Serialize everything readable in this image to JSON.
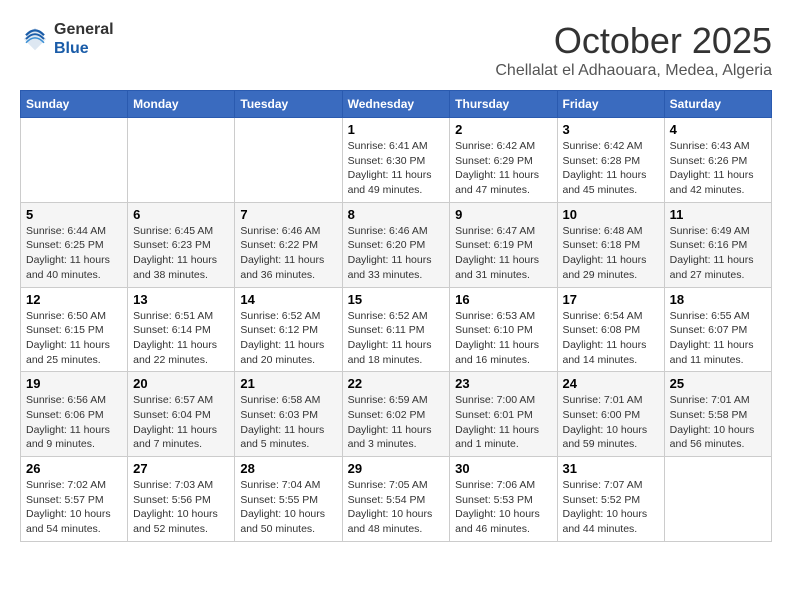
{
  "header": {
    "logo_general": "General",
    "logo_blue": "Blue",
    "month_title": "October 2025",
    "subtitle": "Chellalat el Adhaouara, Medea, Algeria"
  },
  "calendar": {
    "weekdays": [
      "Sunday",
      "Monday",
      "Tuesday",
      "Wednesday",
      "Thursday",
      "Friday",
      "Saturday"
    ],
    "weeks": [
      [
        {
          "day": "",
          "info": ""
        },
        {
          "day": "",
          "info": ""
        },
        {
          "day": "",
          "info": ""
        },
        {
          "day": "1",
          "info": "Sunrise: 6:41 AM\nSunset: 6:30 PM\nDaylight: 11 hours and 49 minutes."
        },
        {
          "day": "2",
          "info": "Sunrise: 6:42 AM\nSunset: 6:29 PM\nDaylight: 11 hours and 47 minutes."
        },
        {
          "day": "3",
          "info": "Sunrise: 6:42 AM\nSunset: 6:28 PM\nDaylight: 11 hours and 45 minutes."
        },
        {
          "day": "4",
          "info": "Sunrise: 6:43 AM\nSunset: 6:26 PM\nDaylight: 11 hours and 42 minutes."
        }
      ],
      [
        {
          "day": "5",
          "info": "Sunrise: 6:44 AM\nSunset: 6:25 PM\nDaylight: 11 hours and 40 minutes."
        },
        {
          "day": "6",
          "info": "Sunrise: 6:45 AM\nSunset: 6:23 PM\nDaylight: 11 hours and 38 minutes."
        },
        {
          "day": "7",
          "info": "Sunrise: 6:46 AM\nSunset: 6:22 PM\nDaylight: 11 hours and 36 minutes."
        },
        {
          "day": "8",
          "info": "Sunrise: 6:46 AM\nSunset: 6:20 PM\nDaylight: 11 hours and 33 minutes."
        },
        {
          "day": "9",
          "info": "Sunrise: 6:47 AM\nSunset: 6:19 PM\nDaylight: 11 hours and 31 minutes."
        },
        {
          "day": "10",
          "info": "Sunrise: 6:48 AM\nSunset: 6:18 PM\nDaylight: 11 hours and 29 minutes."
        },
        {
          "day": "11",
          "info": "Sunrise: 6:49 AM\nSunset: 6:16 PM\nDaylight: 11 hours and 27 minutes."
        }
      ],
      [
        {
          "day": "12",
          "info": "Sunrise: 6:50 AM\nSunset: 6:15 PM\nDaylight: 11 hours and 25 minutes."
        },
        {
          "day": "13",
          "info": "Sunrise: 6:51 AM\nSunset: 6:14 PM\nDaylight: 11 hours and 22 minutes."
        },
        {
          "day": "14",
          "info": "Sunrise: 6:52 AM\nSunset: 6:12 PM\nDaylight: 11 hours and 20 minutes."
        },
        {
          "day": "15",
          "info": "Sunrise: 6:52 AM\nSunset: 6:11 PM\nDaylight: 11 hours and 18 minutes."
        },
        {
          "day": "16",
          "info": "Sunrise: 6:53 AM\nSunset: 6:10 PM\nDaylight: 11 hours and 16 minutes."
        },
        {
          "day": "17",
          "info": "Sunrise: 6:54 AM\nSunset: 6:08 PM\nDaylight: 11 hours and 14 minutes."
        },
        {
          "day": "18",
          "info": "Sunrise: 6:55 AM\nSunset: 6:07 PM\nDaylight: 11 hours and 11 minutes."
        }
      ],
      [
        {
          "day": "19",
          "info": "Sunrise: 6:56 AM\nSunset: 6:06 PM\nDaylight: 11 hours and 9 minutes."
        },
        {
          "day": "20",
          "info": "Sunrise: 6:57 AM\nSunset: 6:04 PM\nDaylight: 11 hours and 7 minutes."
        },
        {
          "day": "21",
          "info": "Sunrise: 6:58 AM\nSunset: 6:03 PM\nDaylight: 11 hours and 5 minutes."
        },
        {
          "day": "22",
          "info": "Sunrise: 6:59 AM\nSunset: 6:02 PM\nDaylight: 11 hours and 3 minutes."
        },
        {
          "day": "23",
          "info": "Sunrise: 7:00 AM\nSunset: 6:01 PM\nDaylight: 11 hours and 1 minute."
        },
        {
          "day": "24",
          "info": "Sunrise: 7:01 AM\nSunset: 6:00 PM\nDaylight: 10 hours and 59 minutes."
        },
        {
          "day": "25",
          "info": "Sunrise: 7:01 AM\nSunset: 5:58 PM\nDaylight: 10 hours and 56 minutes."
        }
      ],
      [
        {
          "day": "26",
          "info": "Sunrise: 7:02 AM\nSunset: 5:57 PM\nDaylight: 10 hours and 54 minutes."
        },
        {
          "day": "27",
          "info": "Sunrise: 7:03 AM\nSunset: 5:56 PM\nDaylight: 10 hours and 52 minutes."
        },
        {
          "day": "28",
          "info": "Sunrise: 7:04 AM\nSunset: 5:55 PM\nDaylight: 10 hours and 50 minutes."
        },
        {
          "day": "29",
          "info": "Sunrise: 7:05 AM\nSunset: 5:54 PM\nDaylight: 10 hours and 48 minutes."
        },
        {
          "day": "30",
          "info": "Sunrise: 7:06 AM\nSunset: 5:53 PM\nDaylight: 10 hours and 46 minutes."
        },
        {
          "day": "31",
          "info": "Sunrise: 7:07 AM\nSunset: 5:52 PM\nDaylight: 10 hours and 44 minutes."
        },
        {
          "day": "",
          "info": ""
        }
      ]
    ]
  }
}
